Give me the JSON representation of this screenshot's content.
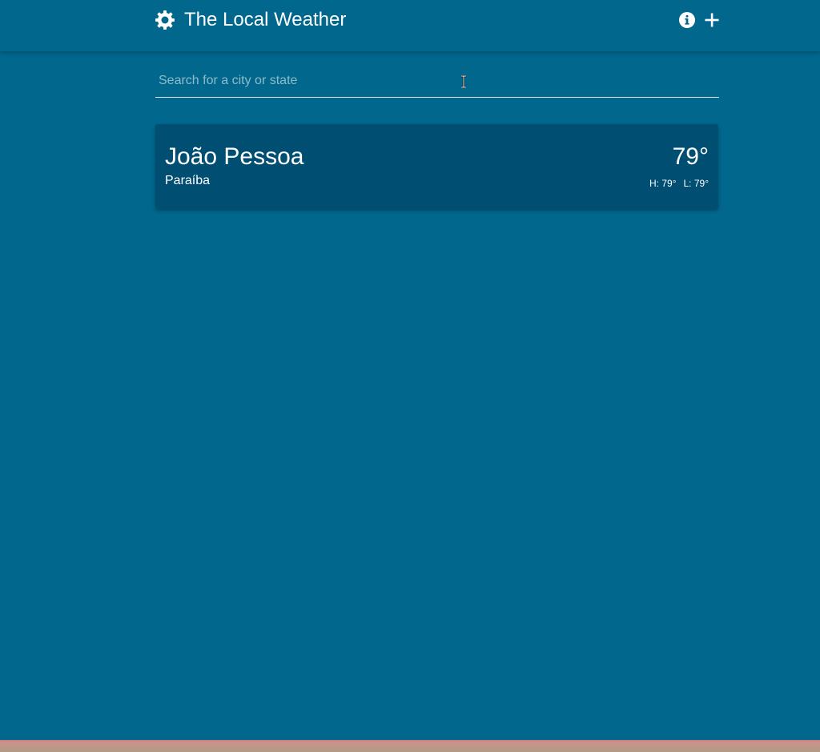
{
  "header": {
    "title": "The Local Weather",
    "brand_icon": "gear-sun-icon",
    "actions": [
      {
        "name": "info-icon"
      },
      {
        "name": "plus-icon"
      }
    ]
  },
  "search": {
    "placeholder": "Search for a city or state",
    "value": ""
  },
  "cards": [
    {
      "city": "João Pessoa",
      "state": "Paraíba",
      "temperature": "79°",
      "high": "H: 79°",
      "low": "L: 79°"
    }
  ],
  "colors": {
    "background": "#01678c",
    "card": "#004f73",
    "text": "#ffffff",
    "bottom_strip": "#c7948c"
  }
}
